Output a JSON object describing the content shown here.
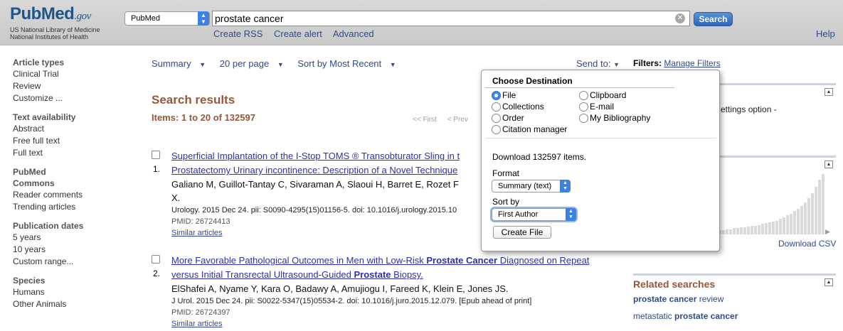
{
  "header": {
    "logo_word": "PubMed",
    "logo_suffix": ".gov",
    "logo_line1": "US National Library of Medicine",
    "logo_line2": "National Institutes of Health",
    "db_select": "PubMed",
    "search_query": "prostate cancer",
    "search_button": "Search",
    "links": [
      "Create RSS",
      "Create alert",
      "Advanced"
    ],
    "help": "Help"
  },
  "sidebar": {
    "groups": [
      {
        "title": "Article types",
        "items": [
          "Clinical Trial",
          "Review",
          "Customize ..."
        ]
      },
      {
        "title": "Text availability",
        "items": [
          "Abstract",
          "Free full text",
          "Full text"
        ]
      },
      {
        "title": "PubMed Commons",
        "items": [
          "Reader comments",
          "Trending articles"
        ]
      },
      {
        "title": "Publication dates",
        "items": [
          "5 years",
          "10 years",
          "Custom range..."
        ]
      },
      {
        "title": "Species",
        "items": [
          "Humans",
          "Other Animals"
        ]
      }
    ]
  },
  "toolbar": {
    "summary": "Summary",
    "per_page": "20 per page",
    "sort": "Sort by Most Recent",
    "send_to": "Send to:"
  },
  "results": {
    "heading": "Search results",
    "items_label": "Items: 1 to 20 of 132597",
    "pager_first": "<< First",
    "pager_prev": "< Prev",
    "list": [
      {
        "number": "1.",
        "title_line1": "Superficial Implantation of the I-Stop TOMS ® Transobturator Sling in t",
        "title_line2": "Prostatectomy Urinary incontinence: Description of a Novel Technique",
        "authors_line1": "Galiano M, Guillot-Tantay C, Sivaraman A, Slaoui H, Barret E, Rozet F",
        "authors_line2": "X.",
        "citation": "Urology. 2015 Dec 24. pii: S0090-4295(15)01156-5. doi: 10.1016/j.urology.2015.10",
        "pmid": "PMID: 26724413",
        "similar": "Similar articles"
      },
      {
        "number": "2.",
        "title_a": "More Favorable Pathological Outcomes in Men with Low-Risk ",
        "title_b": "Prostate Cancer",
        "title_c": " Diagnosed on Repeat",
        "title_d": "versus Initial Transrectal Ultrasound-Guided ",
        "title_e": "Prostate",
        "title_f": " Biopsy.",
        "authors": "ElShafei A, Nyame Y, Kara O, Badawy A, Amujiogu I, Fareed K, Klein E, Jones JS.",
        "citation": "J Urol. 2015 Dec 24. pii: S0022-5347(15)05534-2. doi: 10.1016/j.juro.2015.12.079. [Epub ahead of print]",
        "pmid": "PMID: 26724397",
        "similar": "Similar articles"
      }
    ]
  },
  "right": {
    "filters_label": "Filters:",
    "manage_filters": "Manage Filters",
    "settings_text": "ettings option -",
    "download_csv": "Download CSV",
    "chart_data": {
      "type": "bar",
      "values": [
        5,
        5,
        6,
        6,
        7,
        7,
        8,
        8,
        9,
        10,
        10,
        11,
        12,
        13,
        14,
        15,
        16,
        18,
        20,
        22,
        24,
        27,
        30,
        33,
        37,
        42,
        48,
        55,
        63,
        70
      ]
    },
    "related_title": "Related searches",
    "related": [
      {
        "bold": "prostate cancer",
        "rest": " review"
      },
      {
        "pre": "metastatic ",
        "bold": "prostate cancer"
      }
    ]
  },
  "popup": {
    "heading": "Choose Destination",
    "options": [
      {
        "label": "File",
        "selected": true
      },
      {
        "label": "Clipboard",
        "selected": false
      },
      {
        "label": "Collections",
        "selected": false
      },
      {
        "label": "E-mail",
        "selected": false
      },
      {
        "label": "Order",
        "selected": false
      },
      {
        "label": "My Bibliography",
        "selected": false
      },
      {
        "label": "Citation manager",
        "selected": false
      }
    ],
    "download_text": "Download 132597 items.",
    "format_label": "Format",
    "format_value": "Summary (text)",
    "sort_label": "Sort by",
    "sort_value": "First Author",
    "create_button": "Create File"
  },
  "colors": {
    "header_bg": "#d0d0d0",
    "link": "#2f4a8f",
    "title_link": "#2f2fb0",
    "heading": "#985735",
    "search_btn": "#2d66b8"
  }
}
